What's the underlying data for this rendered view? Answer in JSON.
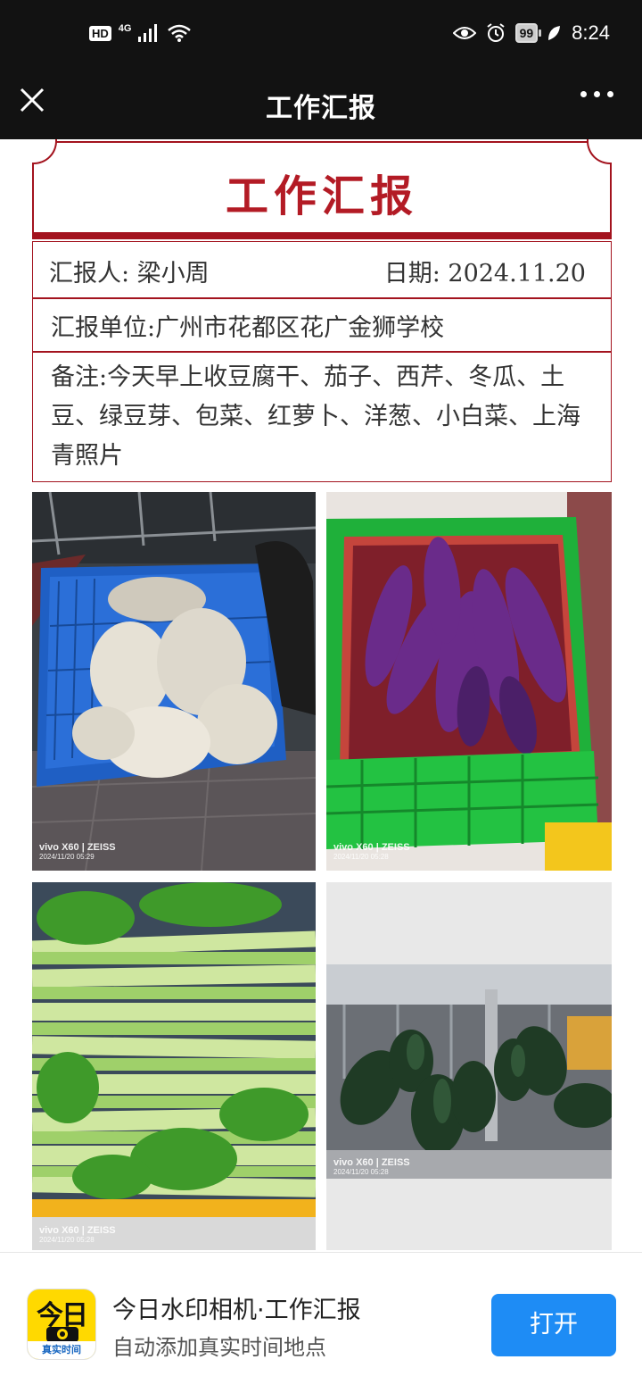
{
  "status_bar": {
    "hd_badge": "HD",
    "network_label": "4G",
    "battery": "99",
    "time": "8:24",
    "icons": [
      "signal-icon",
      "wifi-icon",
      "eye-icon",
      "alarm-icon",
      "leaf-icon"
    ]
  },
  "nav": {
    "title": "工作汇报",
    "icons": [
      "close-icon",
      "more-icon"
    ]
  },
  "report": {
    "title": "工作汇报",
    "reporter_label": "汇报人:  梁小周",
    "date_label": "日期:  2024.11.20",
    "unit_label": "汇报单位:广州市花都区花广金狮学校",
    "remark": "备注:今天早上收豆腐干、茄子、西芹、冬瓜、土豆、绿豆芽、包菜、红萝卜、洋葱、小白菜、上海青照片",
    "accent_color": "#b31b25"
  },
  "photos": [
    {
      "subject": "tofu",
      "watermark_device": "vivo X60 | ZEISS",
      "watermark_time": "2024/11/20 05:29"
    },
    {
      "subject": "eggplant",
      "watermark_device": "vivo X60 | ZEISS",
      "watermark_time": "2024/11/20 05:28"
    },
    {
      "subject": "celery",
      "watermark_device": "vivo X60 | ZEISS",
      "watermark_time": "2024/11/20 05:28"
    },
    {
      "subject": "winter-melon",
      "watermark_device": "vivo X60 | ZEISS",
      "watermark_time": "2024/11/20 05:28"
    }
  ],
  "banner": {
    "app_icon_big": "今日",
    "app_icon_tag": "真实时间",
    "app_name": "今日水印相机·工作汇报",
    "app_desc": "自动添加真实时间地点",
    "open_button": "打开",
    "button_color": "#1e8cf5"
  }
}
